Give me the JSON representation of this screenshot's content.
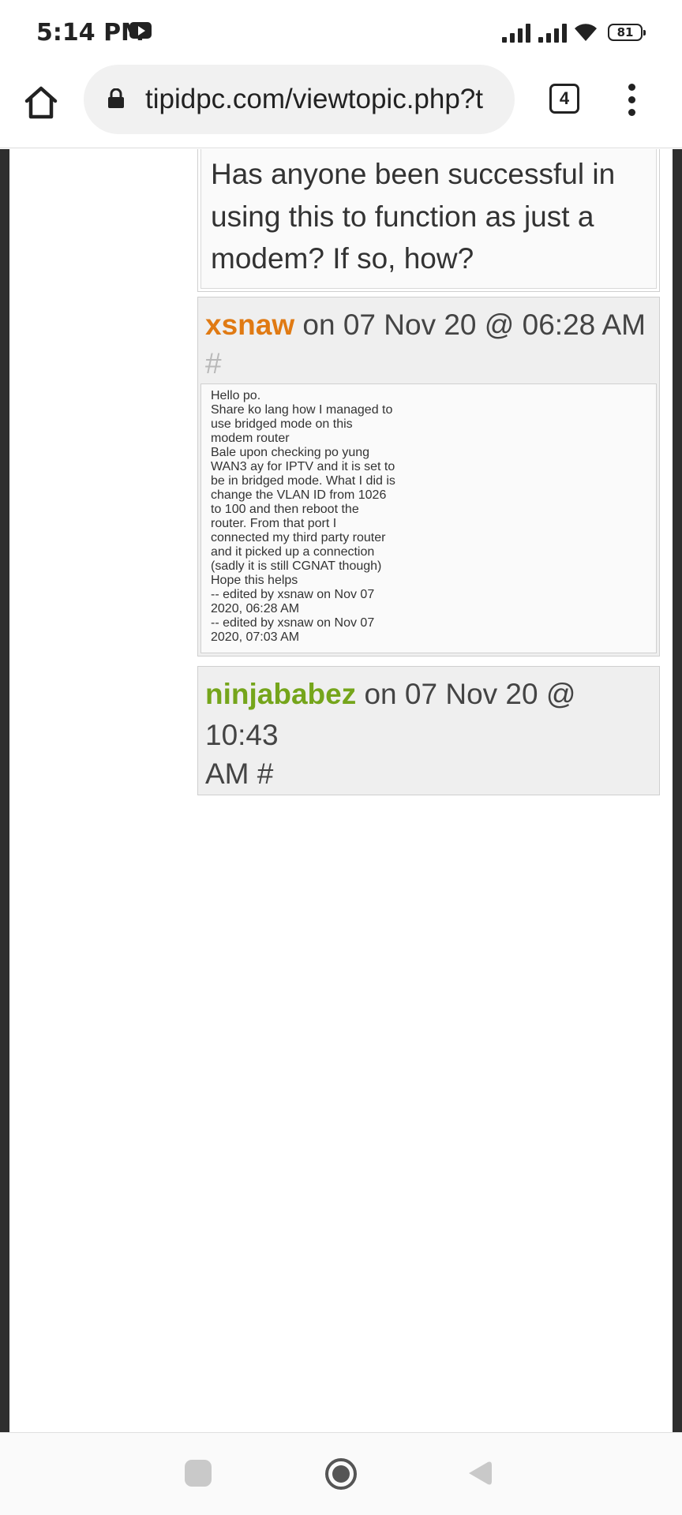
{
  "status_bar": {
    "time": "5:14 PM",
    "battery": "81"
  },
  "browser": {
    "url": "tipidpc.com/viewtopic.php?t",
    "tab_count": "4"
  },
  "previous_post": {
    "lines": [
      "Has anyone been successful in",
      "using this to function as just a",
      "modem? If so, how?"
    ]
  },
  "post1": {
    "author": "xsnaw",
    "meta": " on 07 Nov 20 @ 06:28 AM",
    "hash": "#",
    "paragraphs": [
      [
        "Hello po."
      ],
      [
        "Share ko lang how I managed to",
        "use bridged mode on this",
        "modem router"
      ],
      [
        "Bale upon checking po yung",
        "WAN3 ay for IPTV and it is set to",
        "be in bridged mode. What I did is",
        "change the VLAN ID from 1026",
        "to 100 and then reboot the",
        "router. From that port I",
        "connected my third party router",
        "and it picked up a connection",
        "(sadly it is still CGNAT though)"
      ],
      [
        "Hope this helps"
      ],
      [
        "-- edited by xsnaw on Nov 07",
        "2020, 06:28 AM"
      ],
      [
        "-- edited by xsnaw on Nov 07",
        "2020, 07:03 AM"
      ]
    ]
  },
  "post2": {
    "author": "ninjababez",
    "meta": " on 07 Nov 20 @ 10:43",
    "meta_cont": "AM #"
  },
  "icons": {
    "status": [
      "youtube-icon",
      "signal-icon",
      "signal-icon",
      "wifi-icon",
      "battery-icon"
    ],
    "toolbar": [
      "home-icon",
      "lock-icon",
      "tab-switcher-icon",
      "more-vert-icon"
    ],
    "nav": [
      "recent-apps-icon",
      "home-nav-icon",
      "back-icon"
    ]
  }
}
